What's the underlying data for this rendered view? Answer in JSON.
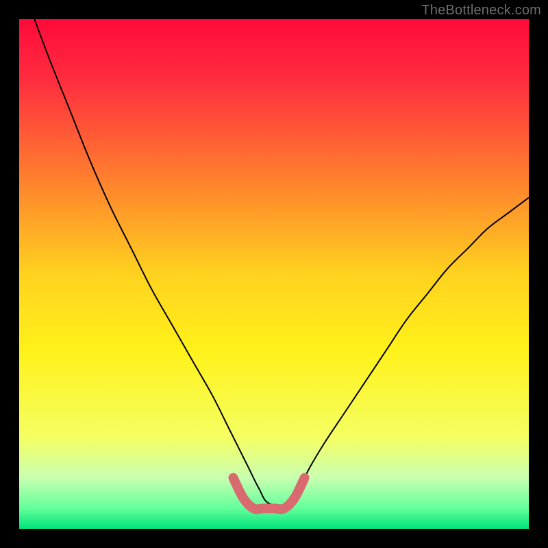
{
  "watermark": "TheBottleneck.com",
  "chart_data": {
    "type": "line",
    "title": "",
    "xlabel": "",
    "ylabel": "",
    "xlim": [
      0,
      100
    ],
    "ylim": [
      0,
      100
    ],
    "gradient_stops": [
      {
        "offset": 0,
        "color": "#ff0a3a"
      },
      {
        "offset": 12,
        "color": "#ff2d3f"
      },
      {
        "offset": 30,
        "color": "#ff7a2f"
      },
      {
        "offset": 50,
        "color": "#ffd21f"
      },
      {
        "offset": 65,
        "color": "#fff11a"
      },
      {
        "offset": 82,
        "color": "#f5ff62"
      },
      {
        "offset": 90,
        "color": "#c9ffb0"
      },
      {
        "offset": 96,
        "color": "#62ff9b"
      },
      {
        "offset": 100,
        "color": "#00e37a"
      }
    ],
    "series": [
      {
        "name": "bottleneck-curve",
        "color": "#000000",
        "stroke_width": 2,
        "x": [
          3,
          6,
          10,
          14,
          18,
          22,
          26,
          30,
          34,
          38,
          41,
          43,
          45,
          47,
          49,
          53,
          55,
          57,
          60,
          64,
          68,
          72,
          76,
          80,
          84,
          88,
          92,
          96,
          100
        ],
        "y": [
          100,
          92,
          82,
          72,
          63,
          55,
          47,
          40,
          33,
          26,
          20,
          16,
          12,
          8,
          5,
          5,
          8,
          12,
          17,
          23,
          29,
          35,
          41,
          46,
          51,
          55,
          59,
          62,
          65
        ]
      },
      {
        "name": "optimal-range-marker",
        "color": "#d96a6f",
        "stroke_width": 14,
        "linecap": "round",
        "x": [
          42,
          44,
          46,
          48,
          50,
          52,
          54,
          56
        ],
        "y": [
          10,
          6,
          4,
          4,
          4,
          4,
          6,
          10
        ]
      }
    ]
  }
}
